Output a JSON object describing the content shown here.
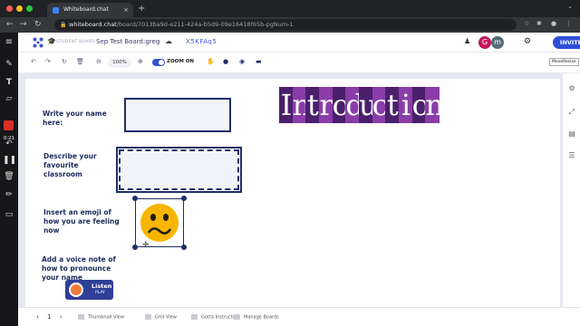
{
  "browser": {
    "tab_title": "Whiteboard.chat",
    "tab_close": "×",
    "new_tab": "+",
    "url_host": "whiteboard.chat",
    "url_path": "/board/7013ba9d-e211-424a-b5d9-09e16418f65b-pgNum-1",
    "colors": {
      "close": "#ff5f57",
      "minimize": "#febc2e",
      "maximize": "#28c840"
    }
  },
  "left_toolbar": {
    "timer": "0:21",
    "tools": [
      "menu-icon",
      "pen-icon",
      "text-icon",
      "eraser-icon",
      "record-icon",
      "undo-icon",
      "pause-icon",
      "trash-icon",
      "pen-small-icon",
      "camera-icon"
    ]
  },
  "header": {
    "student_label": "STUDENT BOARD:",
    "board_name": "Sep Test Board:greg",
    "board_code": "X5KFAq5",
    "avatars": [
      {
        "letter": "G",
        "color": "#c2185b"
      },
      {
        "letter": "m",
        "color": "#546e7a"
      }
    ],
    "invite_label": "INVITE"
  },
  "subbar": {
    "zoom_level": "100%",
    "zoom_on_label": "ZOOM ON",
    "move_resize_label": "MoveResize"
  },
  "canvas": {
    "title": "Introduction",
    "prompts": {
      "name": "Write your name here:",
      "classroom": "Describe your favourite classroom",
      "emoji": "Insert an emoji of how you are feeling now",
      "voice": "Add a voice note of how to pronounce your name"
    },
    "listen_label": "Listen",
    "play_label": "PLAY",
    "colors": {
      "box_border": "#1d2f66",
      "title_dark": "#4a1f6c",
      "title_light": "#8a3da8",
      "emoji": "#f7b500"
    }
  },
  "bottom_bar": {
    "page_number": "1",
    "prev": "‹",
    "next": "›",
    "items": [
      "Thumbnail View",
      "Grid View",
      "Gotta Instructor",
      "Manage Boards"
    ]
  }
}
